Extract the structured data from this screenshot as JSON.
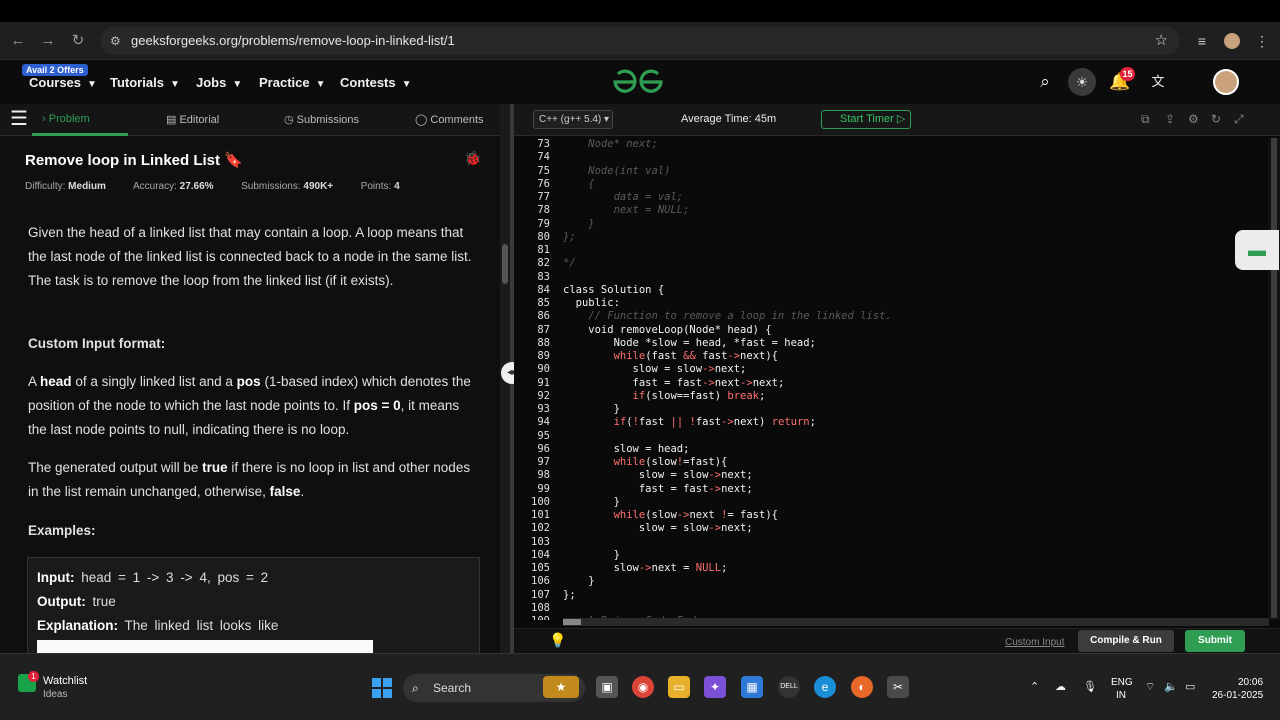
{
  "browser": {
    "url": "geeksforgeeks.org/problems/remove-loop-in-linked-list/1"
  },
  "site_nav": {
    "offer_badge": "Avail 2 Offers",
    "items": [
      "Courses",
      "Tutorials",
      "Jobs",
      "Practice",
      "Contests"
    ],
    "notification_count": "15"
  },
  "problem_tabs": [
    "Problem",
    "Editorial",
    "Submissions",
    "Comments"
  ],
  "problem": {
    "title": "Remove loop in Linked List",
    "difficulty_label": "Difficulty:",
    "difficulty": "Medium",
    "accuracy_label": "Accuracy:",
    "accuracy": "27.66%",
    "submissions_label": "Submissions:",
    "submissions": "490K+",
    "points_label": "Points:",
    "points": "4",
    "description": "Given the head of a linked list that may contain a loop.  A loop means that the last node of the linked list is connected back to a node in the same list. The task is to remove the loop from the linked list (if it exists).",
    "custom_input_heading": "Custom Input format:",
    "custom_input": {
      "a": "A",
      "head": "head",
      "mid1": "of a singly linked list and a",
      "pos": "pos",
      "mid2": "(1-based index) which denotes the position of the node to which the last node points to. If",
      "pos0": "pos = 0",
      "end": ", it means the last node points to null, indicating there is no loop."
    },
    "output_para": {
      "p1": "The generated output will be",
      "true": "true",
      "p2": "if there is no loop in list and other nodes in the list remain unchanged, otherwise,",
      "false": "false",
      "p3": "."
    },
    "examples_heading": "Examples:",
    "example": {
      "input_label": "Input:",
      "input": "head = 1 -> 3 -> 4, pos = 2",
      "output_label": "Output:",
      "output": "true",
      "explanation_label": "Explanation:",
      "explanation": "The linked list looks like"
    }
  },
  "editor": {
    "language": "C++ (g++ 5.4)",
    "avg_time": "Average Time: 45m",
    "start_timer": "Start Timer",
    "custom_input": "Custom Input",
    "compile_run": "Compile & Run",
    "submit": "Submit",
    "code_lines": [
      {
        "n": "73",
        "t": "    Node* next;",
        "style": "comment"
      },
      {
        "n": "74",
        "t": "",
        "style": "comment"
      },
      {
        "n": "75",
        "t": "    Node(int val)",
        "style": "comment"
      },
      {
        "n": "76",
        "t": "    {",
        "style": "comment"
      },
      {
        "n": "77",
        "t": "        data = val;",
        "style": "comment"
      },
      {
        "n": "78",
        "t": "        next = NULL;",
        "style": "comment"
      },
      {
        "n": "79",
        "t": "    }",
        "style": "comment"
      },
      {
        "n": "80",
        "t": "};",
        "style": "comment"
      },
      {
        "n": "81",
        "t": "",
        "style": "comment"
      },
      {
        "n": "82",
        "t": "*/",
        "style": "comment"
      },
      {
        "n": "83",
        "t": "",
        "style": "code"
      },
      {
        "n": "84",
        "t": "class Solution {",
        "style": "code"
      },
      {
        "n": "85",
        "t": "  public:",
        "style": "code"
      },
      {
        "n": "86",
        "t": "    // Function to remove a loop in the linked list.",
        "style": "comment"
      },
      {
        "n": "87",
        "t": "    void removeLoop(Node* head) {",
        "style": "code"
      },
      {
        "n": "88",
        "t": "        Node *slow = head, *fast = head;",
        "style": "code"
      },
      {
        "n": "89",
        "t": "        while(fast && fast->next){",
        "style": "code"
      },
      {
        "n": "90",
        "t": "           slow = slow->next;",
        "style": "code"
      },
      {
        "n": "91",
        "t": "           fast = fast->next->next;",
        "style": "code"
      },
      {
        "n": "92",
        "t": "           if(slow==fast) break;",
        "style": "code"
      },
      {
        "n": "93",
        "t": "        }",
        "style": "code"
      },
      {
        "n": "94",
        "t": "        if(!fast || !fast->next) return;",
        "style": "code"
      },
      {
        "n": "95",
        "t": "",
        "style": "code"
      },
      {
        "n": "96",
        "t": "        slow = head;",
        "style": "code"
      },
      {
        "n": "97",
        "t": "        while(slow!=fast){",
        "style": "code"
      },
      {
        "n": "98",
        "t": "            slow = slow->next;",
        "style": "code"
      },
      {
        "n": "99",
        "t": "            fast = fast->next;",
        "style": "code"
      },
      {
        "n": "100",
        "t": "        }",
        "style": "code"
      },
      {
        "n": "101",
        "t": "        while(slow->next != fast){",
        "style": "code"
      },
      {
        "n": "102",
        "t": "            slow = slow->next;",
        "style": "code"
      },
      {
        "n": "103",
        "t": "",
        "style": "code"
      },
      {
        "n": "104",
        "t": "        }",
        "style": "code"
      },
      {
        "n": "105",
        "t": "        slow->next = NULL;",
        "style": "code"
      },
      {
        "n": "106",
        "t": "    }",
        "style": "code"
      },
      {
        "n": "107",
        "t": "};",
        "style": "code"
      },
      {
        "n": "108",
        "t": "",
        "style": "code"
      },
      {
        "n": "109",
        "t": "    } Driver Code Ends",
        "style": "comment"
      }
    ]
  },
  "taskbar": {
    "watchlist": "Watchlist",
    "ideas": "Ideas",
    "watch_badge": "1",
    "search": "Search",
    "lang1": "ENG",
    "lang2": "IN",
    "time": "20:06",
    "date": "26-01-2025"
  },
  "colors": {
    "accent_green": "#2f9e52",
    "keyword_red": "#ff7070",
    "badge_red": "#e0233a"
  }
}
